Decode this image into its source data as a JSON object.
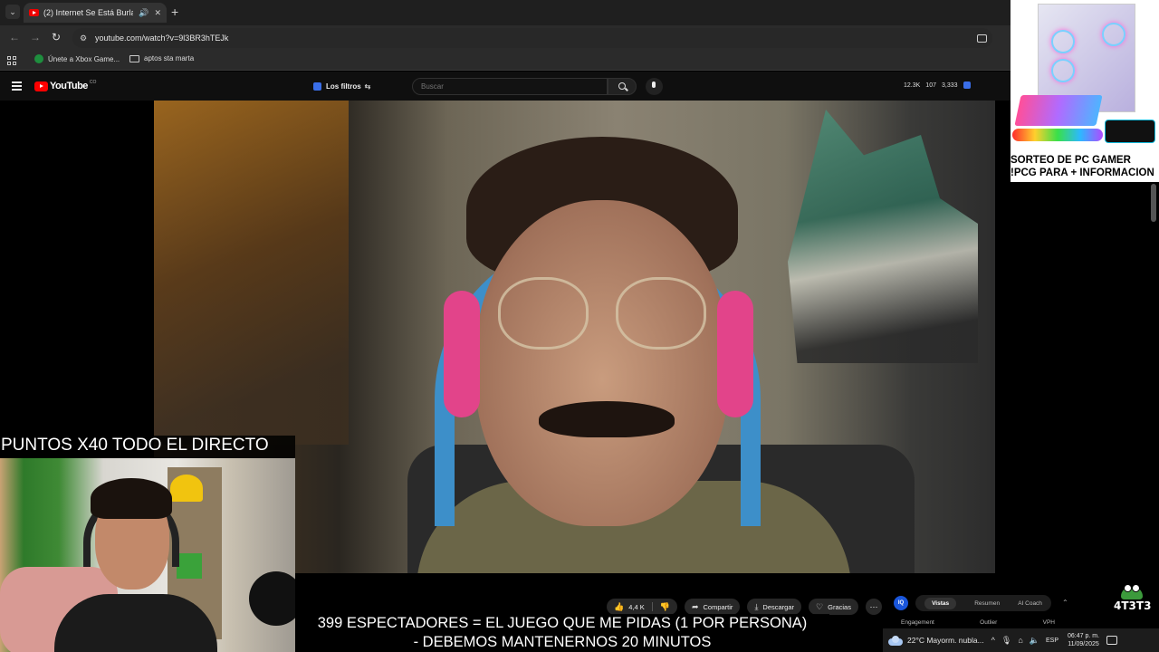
{
  "browser": {
    "tab_title": "(2) Internet Se Está Burlando",
    "new_tab": "+",
    "url": "youtube.com/watch?v=9l3BR3hTEJk",
    "bookmarks": [
      {
        "label": "Únete a Xbox Game...",
        "icon": "xbox-icon"
      },
      {
        "label": "aptos sta marta",
        "icon": "folder-icon"
      }
    ]
  },
  "youtube": {
    "logo_text": "YouTube",
    "logo_country": "CO",
    "filters_label": "Los filtros",
    "search_placeholder": "Buscar",
    "stats": {
      "views": "12.3K",
      "likes": "107",
      "count": "3,333"
    }
  },
  "video_actions": {
    "likes": "4,4 K",
    "share": "Compartir",
    "download": "Descargar",
    "thanks": "Gracias",
    "more": "⋯"
  },
  "overlays": {
    "points_banner": "PUNTOS X40 TODO EL DIRECTO",
    "subtitle_line1": "399 ESPECTADORES = EL JUEGO QUE ME PIDAS (1 POR PERSONA)",
    "subtitle_line2": "- DEBEMOS MANTENERNOS 20 MINUTOS",
    "promo_line1": "SORTEO DE PC GAMER",
    "promo_line2": "!PCG PARA + INFORMACION",
    "channel_logo": "4T3T3"
  },
  "analytics": {
    "logo": "IQ",
    "tabs": [
      "Vistas",
      "Resumen",
      "AI Coach"
    ],
    "active_tab": "Vistas",
    "labels": [
      "Engagement",
      "Outlier",
      "VPH"
    ]
  },
  "taskbar": {
    "weather": "22°C  Mayorm. nubla...",
    "language": "ESP",
    "time": "06:47 p. m.",
    "date": "11/09/2025"
  }
}
